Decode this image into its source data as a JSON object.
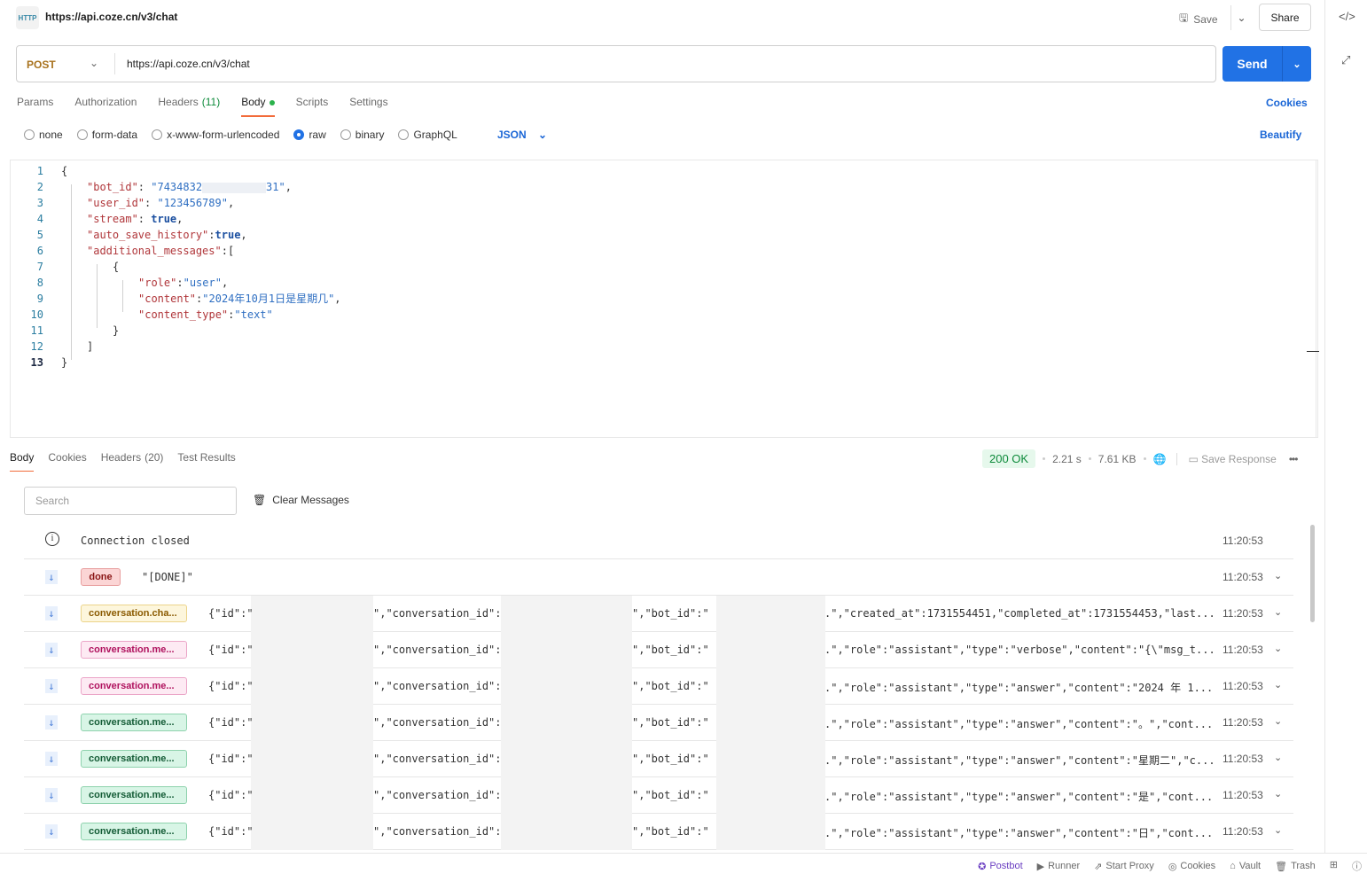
{
  "header": {
    "title": "https://api.coze.cn/v3/chat",
    "http_icon": "HTTP",
    "save": "Save",
    "share": "Share"
  },
  "request": {
    "method": "POST",
    "url": "https://api.coze.cn/v3/chat",
    "send": "Send",
    "method_color": "#a8721d",
    "accent": "#2172e5"
  },
  "tabs": [
    {
      "label": "Params"
    },
    {
      "label": "Authorization"
    },
    {
      "label": "Headers",
      "count": "(11)"
    },
    {
      "label": "Body",
      "active": true
    },
    {
      "label": "Scripts"
    },
    {
      "label": "Settings"
    }
  ],
  "cookies_link": "Cookies",
  "body_types": [
    {
      "label": "none"
    },
    {
      "label": "form-data"
    },
    {
      "label": "x-www-form-urlencoded"
    },
    {
      "label": "raw",
      "selected": true
    },
    {
      "label": "binary"
    },
    {
      "label": "GraphQL"
    }
  ],
  "format": "JSON",
  "beautify": "Beautify",
  "code": [
    [
      [
        "p",
        "{"
      ]
    ],
    [
      [
        "k",
        "\"bot_id\""
      ],
      [
        "p",
        ": "
      ],
      [
        "s",
        "\"7434832"
      ],
      [
        "r",
        ""
      ],
      [
        "s",
        "31\""
      ],
      [
        "p",
        ","
      ]
    ],
    [
      [
        "k",
        "\"user_id\""
      ],
      [
        "p",
        ": "
      ],
      [
        "s",
        "\"123456789\""
      ],
      [
        "p",
        ","
      ]
    ],
    [
      [
        "k",
        "\"stream\""
      ],
      [
        "p",
        ": "
      ],
      [
        "b",
        "true"
      ],
      [
        "p",
        ","
      ]
    ],
    [
      [
        "k",
        "\"auto_save_history\""
      ],
      [
        "p",
        ":"
      ],
      [
        "b",
        "true"
      ],
      [
        "p",
        ","
      ]
    ],
    [
      [
        "k",
        "\"additional_messages\""
      ],
      [
        "p",
        ":["
      ]
    ],
    [
      [
        "p",
        "{"
      ]
    ],
    [
      [
        "k",
        "\"role\""
      ],
      [
        "p",
        ":"
      ],
      [
        "s",
        "\"user\""
      ],
      [
        "p",
        ","
      ]
    ],
    [
      [
        "k",
        "\"content\""
      ],
      [
        "p",
        ":"
      ],
      [
        "s",
        "\"2024年10月1日是星期几\""
      ],
      [
        "p",
        ","
      ]
    ],
    [
      [
        "k",
        "\"content_type\""
      ],
      [
        "p",
        ":"
      ],
      [
        "s",
        "\"text\""
      ]
    ],
    [
      [
        "p",
        "}"
      ]
    ],
    [
      [
        "p",
        "]"
      ]
    ],
    [
      [
        "p",
        "}"
      ]
    ]
  ],
  "code_indent": [
    0,
    1,
    1,
    1,
    1,
    1,
    2,
    3,
    3,
    3,
    2,
    1,
    0
  ],
  "response": {
    "tabs": [
      {
        "label": "Body",
        "active": true
      },
      {
        "label": "Cookies"
      },
      {
        "label": "Headers",
        "count": "(20)"
      },
      {
        "label": "Test Results"
      }
    ],
    "status": "200 OK",
    "time": "2.21 s",
    "size": "7.61 KB",
    "save_response": "Save Response",
    "search_placeholder": "Search",
    "clear_messages": "Clear Messages",
    "connection": {
      "text": "Connection closed",
      "time": "11:20:53"
    },
    "messages": [
      {
        "event": "done",
        "color": "red",
        "p1": "\"[DONE]\"",
        "time": "11:20:53"
      },
      {
        "event": "conversation.cha...",
        "color": "yel",
        "p1": "{\"id\":\"",
        "p2": "\",\"conversation_id\":",
        "p3": "\",\"bot_id\":\"",
        "p4": ".\",\"created_at\":1731554451,\"completed_at\":1731554453,\"last...",
        "time": "11:20:53"
      },
      {
        "event": "conversation.me...",
        "color": "pink",
        "p1": "{\"id\":\"",
        "p2": "\",\"conversation_id\":",
        "p3": "\",\"bot_id\":\"",
        "p4": ".\",\"role\":\"assistant\",\"type\":\"verbose\",\"content\":\"{\\\"msg_t...",
        "time": "11:20:53"
      },
      {
        "event": "conversation.me...",
        "color": "pink",
        "p1": "{\"id\":\"",
        "p2": "\",\"conversation_id\":",
        "p3": "\",\"bot_id\":\"",
        "p4": ".\",\"role\":\"assistant\",\"type\":\"answer\",\"content\":\"2024 年 1...",
        "time": "11:20:53"
      },
      {
        "event": "conversation.me...",
        "color": "grn",
        "p1": "{\"id\":\"",
        "p2": "\",\"conversation_id\":",
        "p3": "\",\"bot_id\":\"",
        "p4": ".\",\"role\":\"assistant\",\"type\":\"answer\",\"content\":\"。\",\"cont...",
        "time": "11:20:53"
      },
      {
        "event": "conversation.me...",
        "color": "grn",
        "p1": "{\"id\":\"",
        "p2": "\",\"conversation_id\":",
        "p3": "\",\"bot_id\":\"",
        "p4": ".\",\"role\":\"assistant\",\"type\":\"answer\",\"content\":\"星期二\",\"c...",
        "time": "11:20:53"
      },
      {
        "event": "conversation.me...",
        "color": "grn",
        "p1": "{\"id\":\"",
        "p2": "\",\"conversation_id\":",
        "p3": "\",\"bot_id\":\"",
        "p4": ".\",\"role\":\"assistant\",\"type\":\"answer\",\"content\":\"是\",\"cont...",
        "time": "11:20:53"
      },
      {
        "event": "conversation.me...",
        "color": "grn",
        "p1": "{\"id\":\"",
        "p2": "\",\"conversation_id\":",
        "p3": "\",\"bot_id\":\"",
        "p4": ".\",\"role\":\"assistant\",\"type\":\"answer\",\"content\":\"日\",\"cont...",
        "time": "11:20:53"
      }
    ]
  },
  "footer": [
    {
      "label": "Postbot",
      "icon": "postbot-icon"
    },
    {
      "label": "Runner",
      "icon": "runner-icon"
    },
    {
      "label": "Start Proxy",
      "icon": "proxy-icon"
    },
    {
      "label": "Cookies",
      "icon": "cookie-icon"
    },
    {
      "label": "Vault",
      "icon": "vault-icon"
    },
    {
      "label": "Trash",
      "icon": "trash-icon"
    }
  ]
}
